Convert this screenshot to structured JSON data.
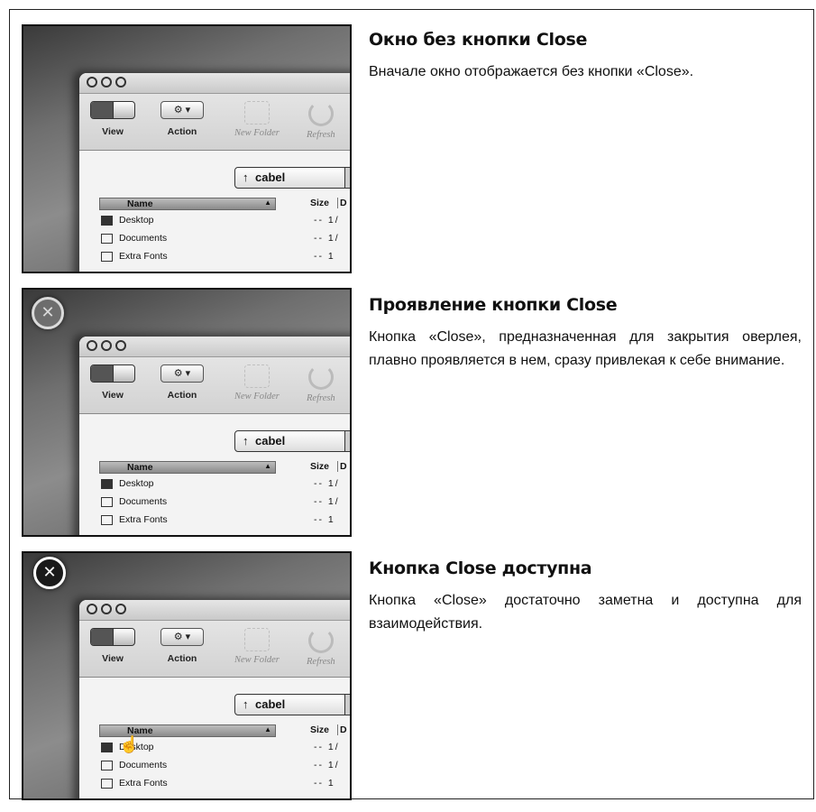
{
  "panels": [
    {
      "heading": "Окно без кнопки Close",
      "description": "Вначале окно отображается без кнопки «Close».",
      "close_button": "none"
    },
    {
      "heading": "Проявление кнопки Close",
      "description": "Кнопка «Close», предназначенная для закрытия оверлея, плавно проявляется в нем, сразу привлекая к себе внимание.",
      "close_button": "fading-in"
    },
    {
      "heading": "Кнопка Close доступна",
      "description": "Кнопка «Close» достаточно заметна и доступна для взаимодействия.",
      "close_button": "visible"
    }
  ],
  "finder": {
    "toolbar": {
      "view_label": "View",
      "action_label": "Action",
      "new_folder_label": "New Folder",
      "refresh_label": "Refresh"
    },
    "path": "cabel",
    "columns": {
      "name": "Name",
      "size": "Size",
      "date": "D"
    },
    "rows": [
      {
        "name": "Desktop",
        "size": "-- 1/"
      },
      {
        "name": "Documents",
        "size": "-- 1/"
      },
      {
        "name": "Extra Fonts",
        "size": "-- 1"
      }
    ]
  },
  "icons": {
    "close": "close-icon",
    "action": "gear-icon",
    "path_arrow": "up-arrow-icon",
    "cursor": "hand-cursor-icon"
  },
  "colors": {
    "frame": "#222222",
    "close_button": "#1a1a1a"
  }
}
